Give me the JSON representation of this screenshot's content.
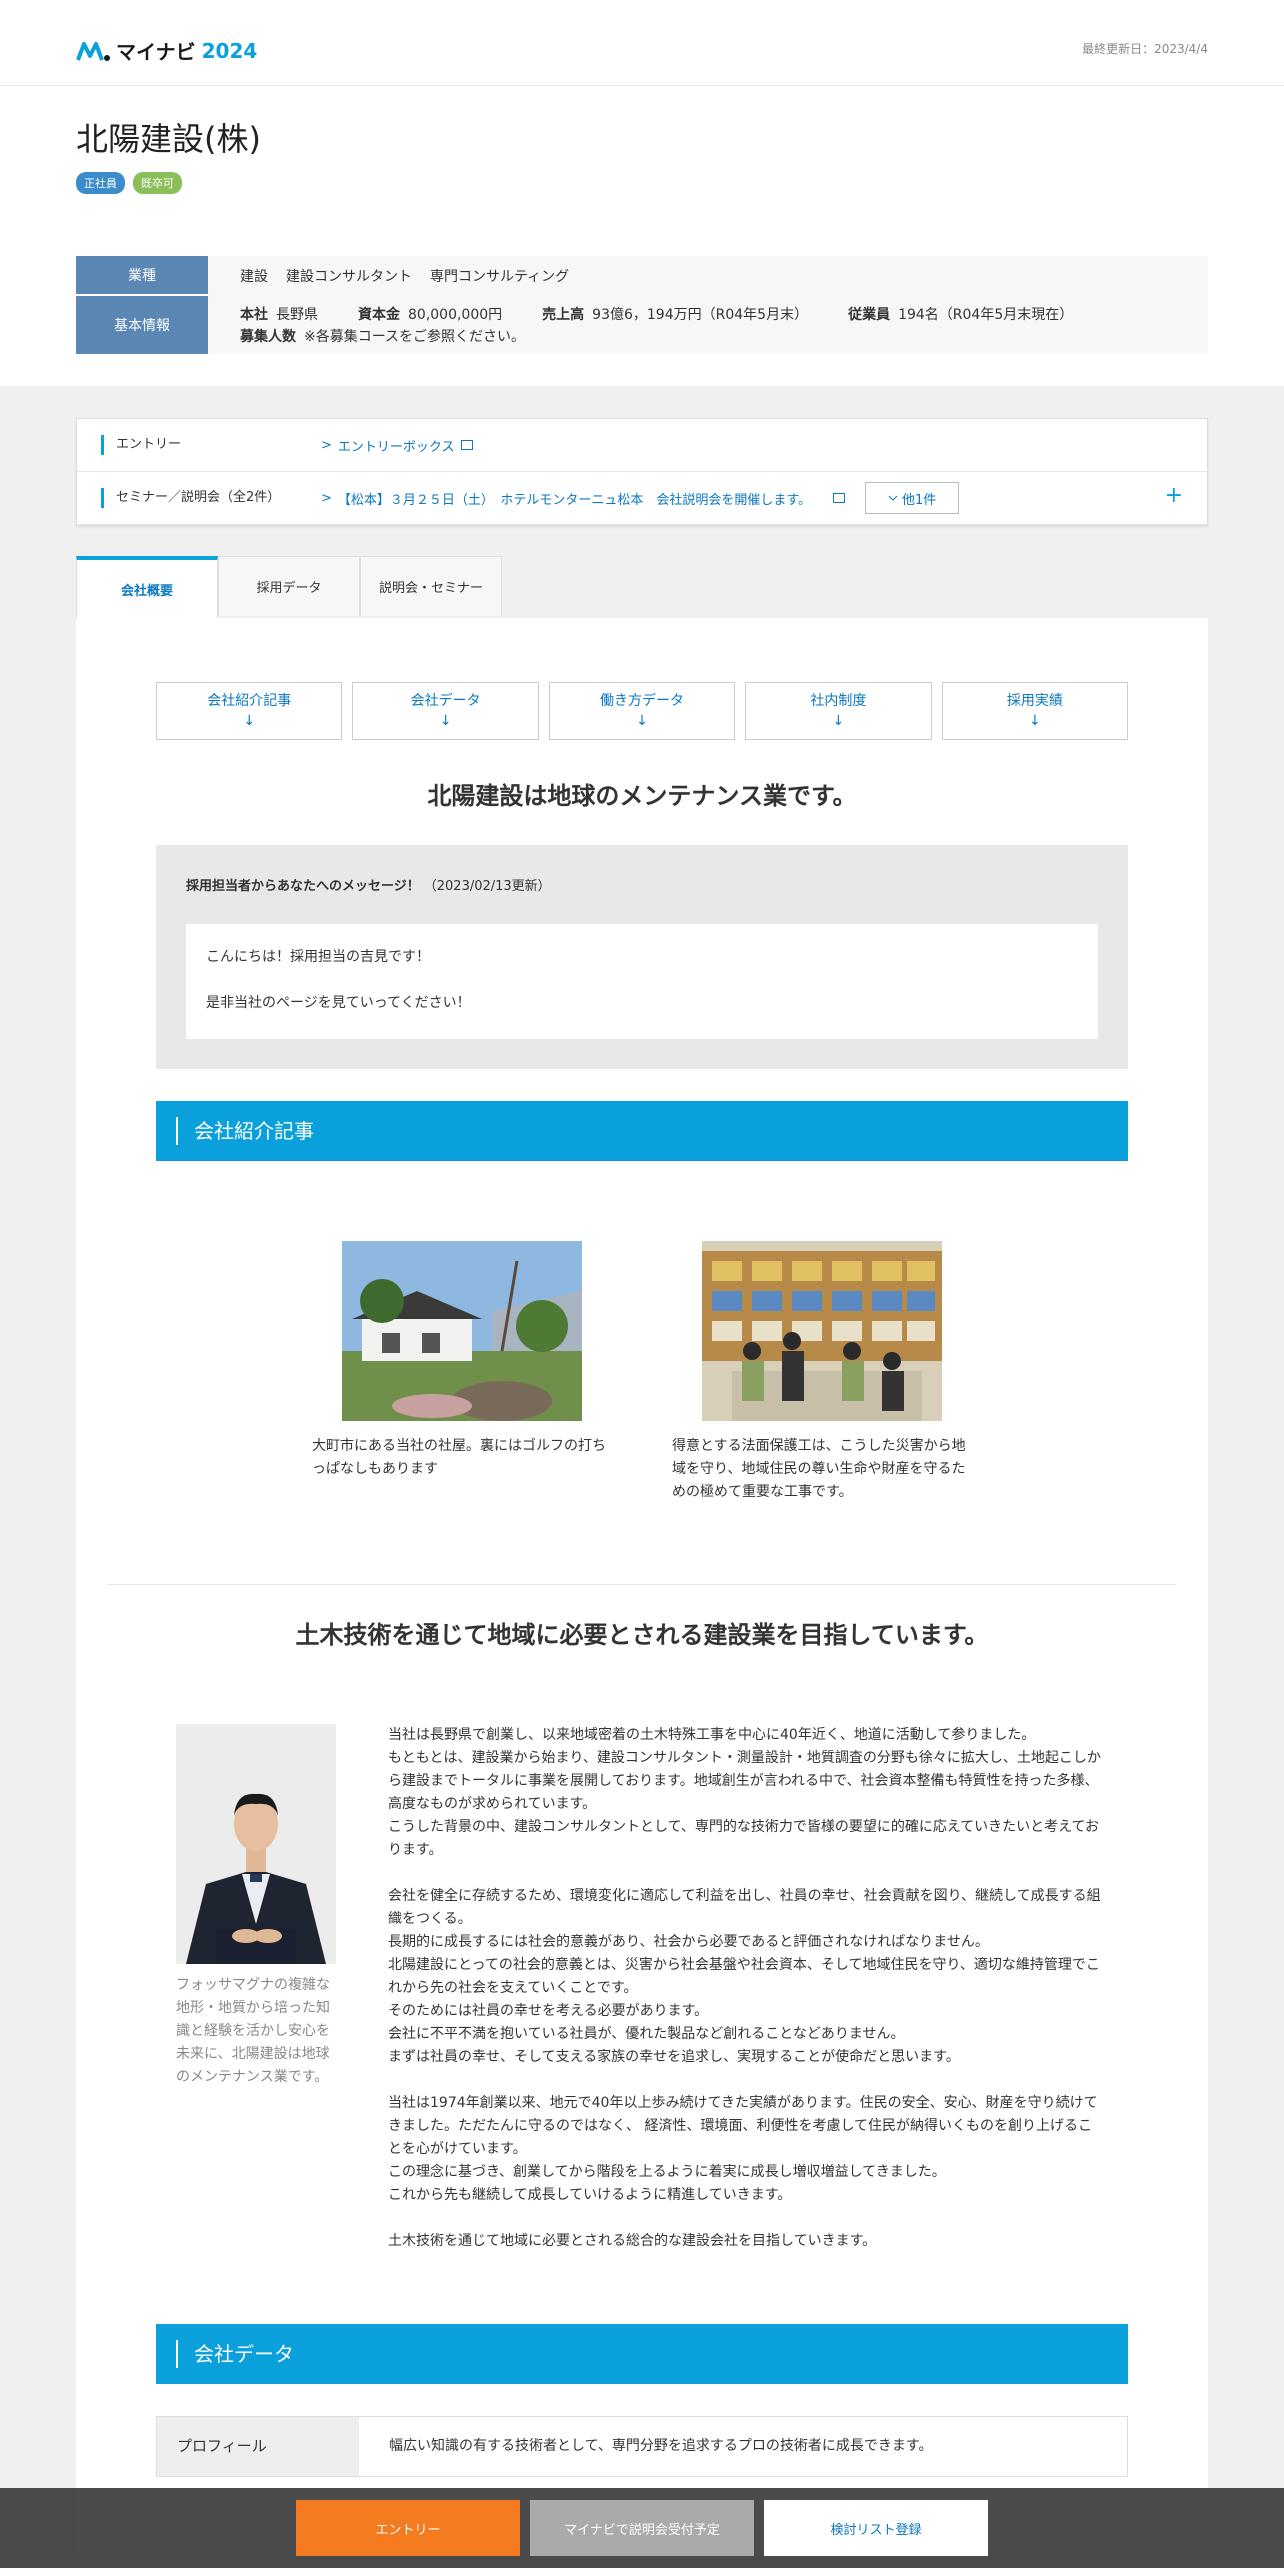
{
  "header": {
    "logo_text": "マイナビ",
    "logo_year": "2024",
    "last_updated": "最終更新日：2023/4/4"
  },
  "company": {
    "name": "北陽建設(株)",
    "badges": [
      "正社員",
      "既卒可"
    ]
  },
  "info": {
    "industry_label": "業種",
    "industry_values": [
      "建設",
      "建設コンサルタント",
      "専門コンサルティング"
    ],
    "basic_label": "基本情報",
    "hq_key": "本社",
    "hq_val": "長野県",
    "capital_key": "資本金",
    "capital_val": "80,000,000円",
    "sales_key": "売上高",
    "sales_val": "93億6，194万円（R04年5月末）",
    "employees_key": "従業員",
    "employees_val": "194名（R04年5月末現在）",
    "recruit_key": "募集人数",
    "recruit_val": "※各募集コースをご参照ください。"
  },
  "entry_panel": {
    "entry_label": "エントリー",
    "entry_link": "エントリーボックス",
    "seminar_label": "セミナー／説明会（全2件）",
    "seminar_link": "【松本】３月２５日（土）　ホテルモンターニュ松本　会社説明会を開催します。",
    "others_button": "他1件",
    "chevron": ">",
    "plus": "+"
  },
  "tabs": [
    "会社概要",
    "採用データ",
    "説明会・セミナー"
  ],
  "nav_buttons": [
    {
      "label": "会社紹介記事",
      "arrow": "↓"
    },
    {
      "label": "会社データ",
      "arrow": "↓"
    },
    {
      "label": "働き方データ",
      "arrow": "↓"
    },
    {
      "label": "社内制度",
      "arrow": "↓"
    },
    {
      "label": "採用実績",
      "arrow": "↓"
    }
  ],
  "catch_copy": "北陽建設は地球のメンテナンス業です。",
  "message": {
    "title": "採用担当者からあなたへのメッセージ！",
    "date": "（2023/02/13更新）",
    "line1": "こんにちは！採用担当の吉見です！",
    "line2": "是非当社のページを見ていってください！"
  },
  "section1_title": "会社紹介記事",
  "photos": [
    {
      "caption": "大町市にある当社の社屋。裏にはゴルフの打ちっぱなしもあります"
    },
    {
      "caption": "得意とする法面保護工は、こうした災害から地域を守り、地域住民の尊い生命や財産を守るための極めて重要な工事です。"
    }
  ],
  "heading2": "土木技術を通じて地域に必要とされる建設業を目指しています。",
  "person_caption": "フォッサマグナの複雑な地形・地質から培った知識と経験を活かし安心を未来に、北陽建設は地球のメンテナンス業です。",
  "intro_paragraphs": [
    "当社は長野県で創業し、以来地域密着の土木特殊工事を中心に40年近く、地道に活動して参りました。\nもともとは、建設業から始まり、建設コンサルタント・測量設計・地質調査の分野も徐々に拡大し、土地起こしから建設までトータルに事業を展開しております。地域創生が言われる中で、社会資本整備も特質性を持った多様、高度なものが求められています。\nこうした背景の中、建設コンサルタントとして、専門的な技術力で皆様の要望に的確に応えていきたいと考えております。",
    "会社を健全に存続するため、環境変化に適応して利益を出し、社員の幸せ、社会貢献を図り、継続して成長する組織をつくる。\n長期的に成長するには社会的意義があり、社会から必要であると評価されなければなりません。\n北陽建設にとっての社会的意義とは、災害から社会基盤や社会資本、そして地域住民を守り、適切な維持管理でこれから先の社会を支えていくことです。\nそのためには社員の幸せを考える必要があります。\n会社に不平不満を抱いている社員が、優れた製品など創れることなどありません。\nまずは社員の幸せ、そして支える家族の幸せを追求し、実現することが使命だと思います。",
    "当社は1974年創業以来、地元で40年以上歩み続けてきた実績があります。住民の安全、安心、財産を守り続けてきました。ただたんに守るのではなく、 経済性、環境面、利便性を考慮して住民が納得いくものを創り上げることを心がけています。\nこの理念に基づき、創業してから階段を上るように着実に成長し増収増益してきました。\nこれから先も継続して成長していけるように精進していきます。",
    "土木技術を通じて地域に必要とされる総合的な建設会社を目指していきます。"
  ],
  "section2_title": "会社データ",
  "profile": {
    "label": "プロフィール",
    "value": "幅広い知識の有する技術者として、専門分野を追求するプロの技術者に成長できます。"
  },
  "bottom_bar": {
    "entry": "エントリー",
    "seminar": "マイナビで説明会受付予定",
    "list": "検討リスト登録"
  }
}
